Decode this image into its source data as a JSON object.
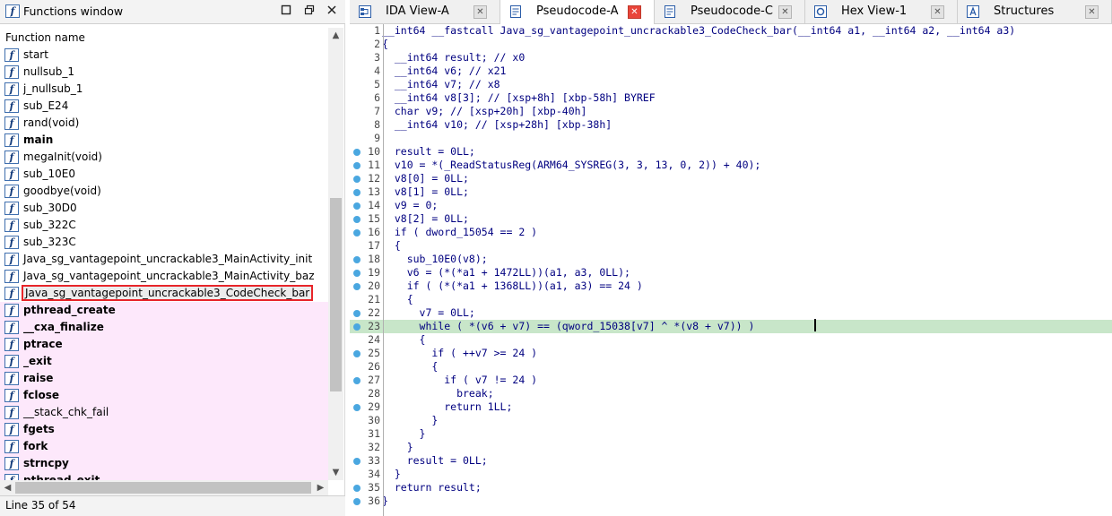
{
  "functions_window": {
    "title": "Functions window",
    "column_header": "Function name",
    "status": "Line 35 of 54",
    "items": [
      {
        "name": "start",
        "bold": false,
        "lib": false
      },
      {
        "name": "nullsub_1",
        "bold": false,
        "lib": false
      },
      {
        "name": "j_nullsub_1",
        "bold": false,
        "lib": false
      },
      {
        "name": "sub_E24",
        "bold": false,
        "lib": false
      },
      {
        "name": "rand(void)",
        "bold": false,
        "lib": false
      },
      {
        "name": "main",
        "bold": true,
        "lib": false
      },
      {
        "name": "megaInit(void)",
        "bold": false,
        "lib": false
      },
      {
        "name": "sub_10E0",
        "bold": false,
        "lib": false
      },
      {
        "name": "goodbye(void)",
        "bold": false,
        "lib": false
      },
      {
        "name": "sub_30D0",
        "bold": false,
        "lib": false
      },
      {
        "name": "sub_322C",
        "bold": false,
        "lib": false
      },
      {
        "name": "sub_323C",
        "bold": false,
        "lib": false
      },
      {
        "name": "Java_sg_vantagepoint_uncrackable3_MainActivity_init",
        "bold": false,
        "lib": false
      },
      {
        "name": "Java_sg_vantagepoint_uncrackable3_MainActivity_baz",
        "bold": false,
        "lib": false
      },
      {
        "name": "Java_sg_vantagepoint_uncrackable3_CodeCheck_bar",
        "bold": false,
        "lib": false,
        "selected": true
      },
      {
        "name": "pthread_create",
        "bold": true,
        "lib": true
      },
      {
        "name": "__cxa_finalize",
        "bold": true,
        "lib": true
      },
      {
        "name": "ptrace",
        "bold": true,
        "lib": true
      },
      {
        "name": "_exit",
        "bold": true,
        "lib": true
      },
      {
        "name": "raise",
        "bold": true,
        "lib": true
      },
      {
        "name": "fclose",
        "bold": true,
        "lib": true
      },
      {
        "name": "__stack_chk_fail",
        "bold": false,
        "lib": true
      },
      {
        "name": "fgets",
        "bold": true,
        "lib": true
      },
      {
        "name": "fork",
        "bold": true,
        "lib": true
      },
      {
        "name": "strncpy",
        "bold": true,
        "lib": true
      },
      {
        "name": "pthread_exit",
        "bold": true,
        "lib": true
      }
    ]
  },
  "tabs": [
    {
      "label": "IDA View-A",
      "icon": "ida-view-icon",
      "active": false
    },
    {
      "label": "Pseudocode-A",
      "icon": "pseudocode-icon",
      "active": true
    },
    {
      "label": "Pseudocode-C",
      "icon": "pseudocode-icon",
      "active": false
    },
    {
      "label": "Hex View-1",
      "icon": "hex-view-icon",
      "active": false
    },
    {
      "label": "Structures",
      "icon": "structures-icon",
      "active": false
    }
  ],
  "code_lines": [
    {
      "n": "1",
      "text": "__int64 __fastcall Java_sg_vantagepoint_uncrackable3_CodeCheck_bar(__int64 a1, __int64 a2, __int64 a3)",
      "dot": false
    },
    {
      "n": "2",
      "text": "{",
      "dot": false
    },
    {
      "n": "3",
      "text": "  __int64 result; // x0",
      "dot": false
    },
    {
      "n": "4",
      "text": "  __int64 v6; // x21",
      "dot": false
    },
    {
      "n": "5",
      "text": "  __int64 v7; // x8",
      "dot": false
    },
    {
      "n": "6",
      "text": "  __int64 v8[3]; // [xsp+8h] [xbp-58h] BYREF",
      "dot": false
    },
    {
      "n": "7",
      "text": "  char v9; // [xsp+20h] [xbp-40h]",
      "dot": false
    },
    {
      "n": "8",
      "text": "  __int64 v10; // [xsp+28h] [xbp-38h]",
      "dot": false
    },
    {
      "n": "9",
      "text": "",
      "dot": false
    },
    {
      "n": "10",
      "text": "  result = 0LL;",
      "dot": true
    },
    {
      "n": "11",
      "text": "  v10 = *(_ReadStatusReg(ARM64_SYSREG(3, 3, 13, 0, 2)) + 40);",
      "dot": true
    },
    {
      "n": "12",
      "text": "  v8[0] = 0LL;",
      "dot": true
    },
    {
      "n": "13",
      "text": "  v8[1] = 0LL;",
      "dot": true
    },
    {
      "n": "14",
      "text": "  v9 = 0;",
      "dot": true
    },
    {
      "n": "15",
      "text": "  v8[2] = 0LL;",
      "dot": true
    },
    {
      "n": "16",
      "text": "  if ( dword_15054 == 2 )",
      "dot": true
    },
    {
      "n": "17",
      "text": "  {",
      "dot": false
    },
    {
      "n": "18",
      "text": "    sub_10E0(v8);",
      "dot": true
    },
    {
      "n": "19",
      "text": "    v6 = (*(*a1 + 1472LL))(a1, a3, 0LL);",
      "dot": true
    },
    {
      "n": "20",
      "text": "    if ( (*(*a1 + 1368LL))(a1, a3) == 24 )",
      "dot": true
    },
    {
      "n": "21",
      "text": "    {",
      "dot": false
    },
    {
      "n": "22",
      "text": "      v7 = 0LL;",
      "dot": true
    },
    {
      "n": "23",
      "text": "      while ( *(v6 + v7) == (qword_15038[v7] ^ *(v8 + v7)) )",
      "dot": true,
      "highlight": true
    },
    {
      "n": "24",
      "text": "      {",
      "dot": false
    },
    {
      "n": "25",
      "text": "        if ( ++v7 >= 24 )",
      "dot": true
    },
    {
      "n": "26",
      "text": "        {",
      "dot": false
    },
    {
      "n": "27",
      "text": "          if ( v7 != 24 )",
      "dot": true
    },
    {
      "n": "28",
      "text": "            break;",
      "dot": false
    },
    {
      "n": "29",
      "text": "          return 1LL;",
      "dot": true
    },
    {
      "n": "30",
      "text": "        }",
      "dot": false
    },
    {
      "n": "31",
      "text": "      }",
      "dot": false
    },
    {
      "n": "32",
      "text": "    }",
      "dot": false
    },
    {
      "n": "33",
      "text": "    result = 0LL;",
      "dot": true
    },
    {
      "n": "34",
      "text": "  }",
      "dot": false
    },
    {
      "n": "35",
      "text": "  return result;",
      "dot": true
    },
    {
      "n": "36",
      "text": "}",
      "dot": true
    }
  ],
  "colors": {
    "breakpoint_dot": "#4aa7e0",
    "highlight_line": "#c8e6c9",
    "library_function_bg": "#fde8fb",
    "selection_outline": "#e8252a",
    "active_tab_close": "#e9453a"
  }
}
